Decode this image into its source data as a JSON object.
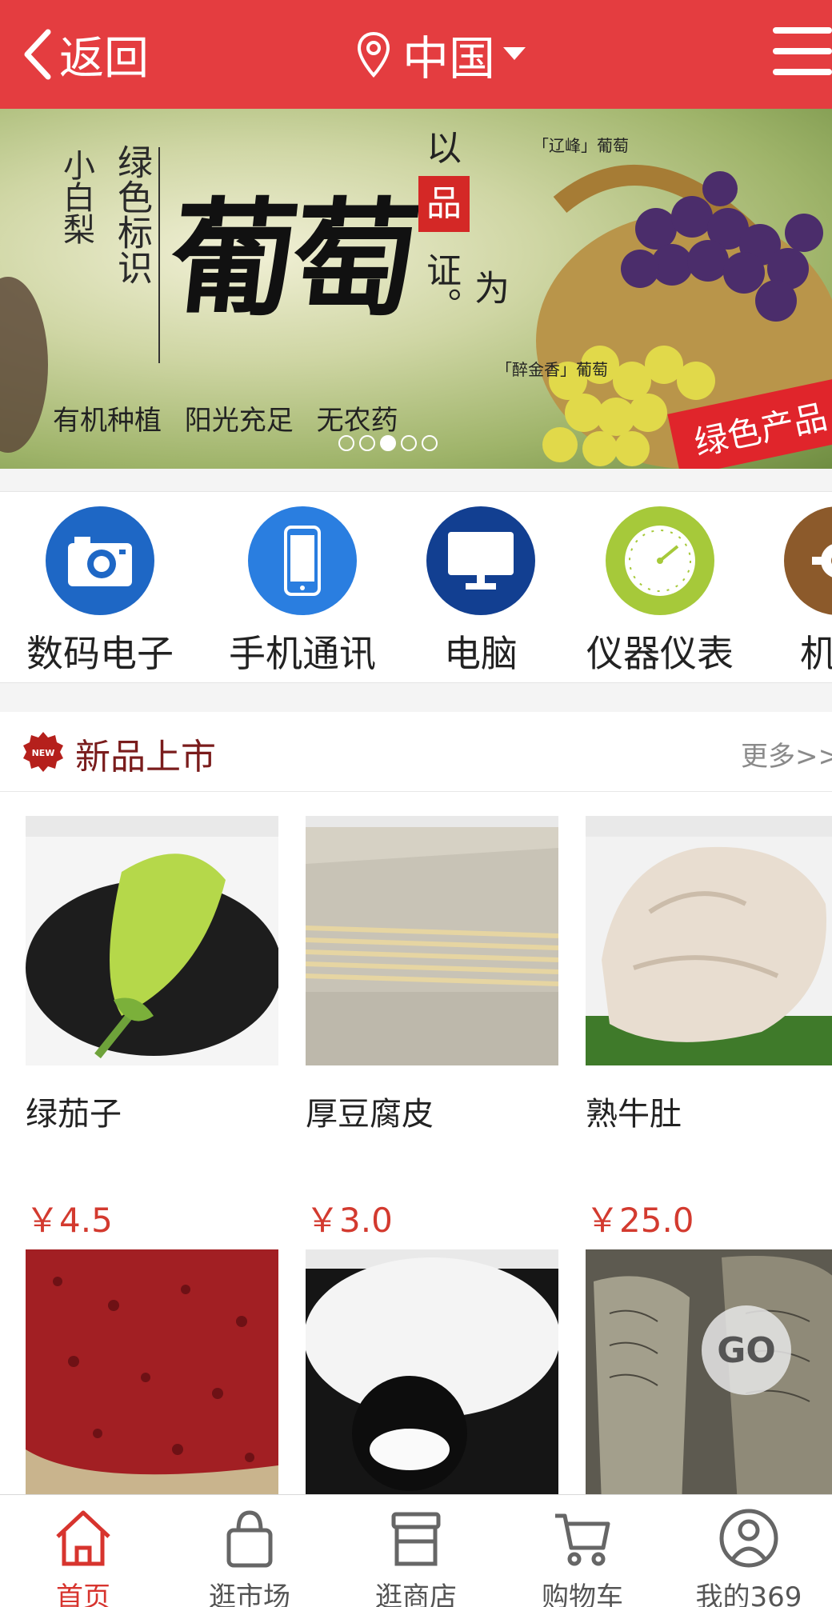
{
  "header": {
    "back_label": "返回",
    "location": "中国"
  },
  "banner": {
    "line_small_1": "小白梨",
    "line_small_2": "绿色标识",
    "headline": "葡萄",
    "vert_1": "以",
    "vert_box": "品",
    "vert_2": "为证。",
    "slogan": "有机种植 阳光充足 无农药",
    "tag1": "「辽峰」葡萄",
    "tag2": "「醉金香」葡萄",
    "ribbon": "绿色产品",
    "slide_count": 5,
    "active_slide": 3
  },
  "categories": [
    {
      "label": "数码电子",
      "icon": "camera-icon",
      "color": "#1e67c5"
    },
    {
      "label": "手机通讯",
      "icon": "phone-icon",
      "color": "#2a7ee0"
    },
    {
      "label": "电脑",
      "icon": "monitor-icon",
      "color": "#123f91"
    },
    {
      "label": "仪器仪表",
      "icon": "gauge-icon",
      "color": "#a6c93a"
    },
    {
      "label": "机",
      "icon": "gear-icon",
      "color": "#8c5a2b"
    }
  ],
  "new_section": {
    "title": "新品上市",
    "more": "更多>>",
    "badge": "NEW"
  },
  "products": [
    {
      "name": "绿茄子",
      "price": "￥4.5"
    },
    {
      "name": "厚豆腐皮",
      "price": "￥3.0"
    },
    {
      "name": "熟牛肚",
      "price": "￥25.0"
    },
    {
      "name": "",
      "price": ""
    },
    {
      "name": "",
      "price": ""
    },
    {
      "name": "",
      "price": ""
    }
  ],
  "go_button": "GO",
  "tabs": [
    {
      "label": "首页",
      "icon": "home-icon",
      "active": true
    },
    {
      "label": "逛市场",
      "icon": "bag-icon"
    },
    {
      "label": "逛商店",
      "icon": "store-icon"
    },
    {
      "label": "购物车",
      "icon": "cart-icon"
    },
    {
      "label": "我的369",
      "icon": "user-icon"
    }
  ],
  "colors": {
    "brand": "#e43d40",
    "price": "#d33a2f"
  }
}
